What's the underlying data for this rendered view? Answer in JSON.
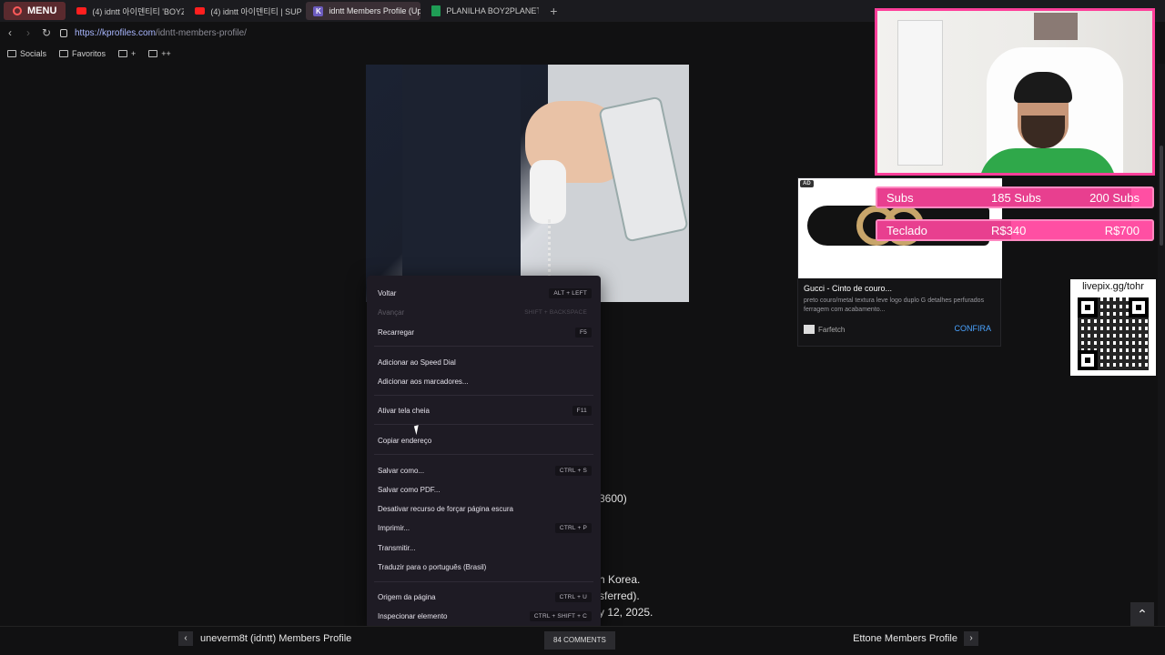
{
  "browser": {
    "menu_label": "MENU",
    "tabs": [
      {
        "label": "(4) idntt 아이덴티티 'BOYZ",
        "icon": "youtube-icon",
        "active": false
      },
      {
        "label": "(4) idntt 아이덴티티 | SUP",
        "icon": "youtube-icon",
        "active": false
      },
      {
        "label": "idntt Members Profile (Up",
        "icon": "kprofiles-icon",
        "active": true
      },
      {
        "label": "PLANILHA BOY2PLANET",
        "icon": "sheets-icon",
        "active": false
      }
    ],
    "new_tab": "+",
    "url_host": "https://kprofiles.com",
    "url_path": "/idntt-members-profile/",
    "bookmarks": [
      {
        "label": "Socials"
      },
      {
        "label": "Favoritos"
      },
      {
        "label": "+"
      },
      {
        "label": "++"
      }
    ]
  },
  "page": {
    "text_fragments": [
      "3600)",
      "h Korea.",
      "sferred).",
      "y 12, 2025."
    ],
    "prev_link": "uneverm8t (idntt) Members Profile",
    "next_link": "Ettone Members Profile",
    "comments_label": "84 COMMENTS"
  },
  "context_menu": {
    "items": [
      {
        "label": "Voltar",
        "shortcut": "ALT + LEFT",
        "disabled": false
      },
      {
        "label": "Avançar",
        "shortcut": "SHIFT + BACKSPACE",
        "disabled": true
      },
      {
        "label": "Recarregar",
        "shortcut": "F5",
        "disabled": false
      },
      {
        "label": "Adicionar ao Speed Dial",
        "shortcut": "",
        "disabled": false
      },
      {
        "label": "Adicionar aos marcadores...",
        "shortcut": "",
        "disabled": false
      },
      {
        "label": "Ativar tela cheia",
        "shortcut": "F11",
        "disabled": false
      },
      {
        "label": "Copiar endereço",
        "shortcut": "",
        "disabled": false
      },
      {
        "label": "Salvar como...",
        "shortcut": "CTRL + S",
        "disabled": false
      },
      {
        "label": "Salvar como PDF...",
        "shortcut": "",
        "disabled": false
      },
      {
        "label": "Desativar recurso de forçar página escura",
        "shortcut": "",
        "disabled": false
      },
      {
        "label": "Imprimir...",
        "shortcut": "CTRL + P",
        "disabled": false
      },
      {
        "label": "Transmitir...",
        "shortcut": "",
        "disabled": false
      },
      {
        "label": "Traduzir para o português (Brasil)",
        "shortcut": "",
        "disabled": false
      },
      {
        "label": "Origem da página",
        "shortcut": "CTRL + U",
        "disabled": false
      },
      {
        "label": "Inspecionar elemento",
        "shortcut": "CTRL + SHIFT + C",
        "disabled": false
      }
    ]
  },
  "ad": {
    "badge": "AD",
    "title": "Gucci - Cinto de couro...",
    "description": "preto couro/metal textura leve logo duplo G detalhes perfurados ferragem com acabamento...",
    "source": "Farfetch",
    "cta": "CONFIRA"
  },
  "stream": {
    "goals": [
      {
        "label": "Subs",
        "current": "185 Subs",
        "target": "200 Subs",
        "progress": 0.925
      },
      {
        "label": "Teclado",
        "current": "R$340",
        "target": "R$700",
        "progress": 0.486
      }
    ],
    "qr_label": "livepix.gg/tohr",
    "accent_color": "#ff4fa3"
  }
}
